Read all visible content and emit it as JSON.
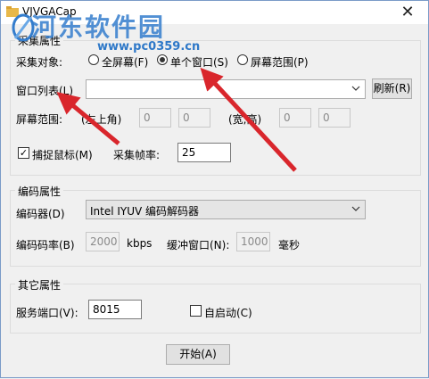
{
  "window": {
    "title": "VJVGACap",
    "close_symbol": "✕"
  },
  "watermark": {
    "text": "河东软件园",
    "url": "www.pc0359.cn"
  },
  "capture": {
    "group_label": "采集属性",
    "object_label": "采集对象:",
    "options": [
      "全屏幕(F)",
      "单个窗口(S)",
      "屏幕范围(P)"
    ],
    "selected_option": "单个窗口(S)",
    "window_list_label": "窗口列表(L)",
    "window_list_value": "",
    "refresh_label": "刷新(R)",
    "screen_range_label": "屏幕范围:",
    "top_left_label": "(左上角)",
    "top_left_x": "0",
    "top_left_y": "0",
    "size_label": "(宽,高)",
    "width": "0",
    "height": "0",
    "capture_mouse_label": "捕捉鼠标(M)",
    "capture_mouse_checked": true,
    "fps_label": "采集帧率:",
    "fps_value": "25"
  },
  "encode": {
    "group_label": "编码属性",
    "encoder_label": "编码器(D)",
    "encoder_value": "Intel IYUV 编码解码器",
    "bitrate_label": "编码码率(B)",
    "bitrate_value": "2000",
    "bitrate_unit": "kbps",
    "buffer_label": "缓冲窗口(N):",
    "buffer_value": "1000",
    "buffer_unit": "毫秒"
  },
  "other": {
    "group_label": "其它属性",
    "port_label": "服务端口(V):",
    "port_value": "8015",
    "autostart_label": "自启动(C)",
    "autostart_checked": false
  },
  "start_button": "开始(A)",
  "colors": {
    "annotation_arrow": "#d9262c",
    "watermark": "#347dcd"
  }
}
